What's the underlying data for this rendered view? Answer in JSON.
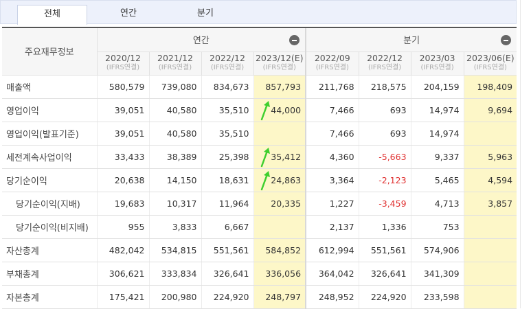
{
  "tabs": [
    {
      "label": "전체",
      "active": true
    },
    {
      "label": "연간",
      "active": false
    },
    {
      "label": "분기",
      "active": false
    }
  ],
  "header": {
    "row_label": "주요재무정보",
    "annual_group": "연간",
    "quarter_group": "분기",
    "periods": [
      {
        "label": "2020/12",
        "sub": "(IFRS연결)"
      },
      {
        "label": "2021/12",
        "sub": "(IFRS연결)"
      },
      {
        "label": "2022/12",
        "sub": "(IFRS연결)"
      },
      {
        "label": "2023/12(E)",
        "sub": "(IFRS연결)"
      },
      {
        "label": "2022/09",
        "sub": "(IFRS연결)"
      },
      {
        "label": "2022/12",
        "sub": "(IFRS연결)"
      },
      {
        "label": "2023/03",
        "sub": "(IFRS연결)"
      },
      {
        "label": "2023/06(E)",
        "sub": "(IFRS연결)"
      }
    ]
  },
  "rows": [
    {
      "label": "매출액",
      "indent": false,
      "arrow": false,
      "values": [
        "580,579",
        "739,080",
        "834,673",
        "857,793",
        "211,768",
        "218,575",
        "204,159",
        "198,409"
      ]
    },
    {
      "label": "영업이익",
      "indent": false,
      "arrow": true,
      "values": [
        "39,051",
        "40,580",
        "35,510",
        "44,000",
        "7,466",
        "693",
        "14,974",
        "9,694"
      ]
    },
    {
      "label": "영업이익(발표기준)",
      "indent": false,
      "arrow": false,
      "values": [
        "39,051",
        "40,580",
        "35,510",
        "",
        "7,466",
        "693",
        "14,974",
        ""
      ]
    },
    {
      "label": "세전계속사업이익",
      "indent": false,
      "arrow": true,
      "values": [
        "33,433",
        "38,389",
        "25,398",
        "35,412",
        "4,360",
        "-5,663",
        "9,337",
        "5,963"
      ]
    },
    {
      "label": "당기순이익",
      "indent": false,
      "arrow": true,
      "values": [
        "20,638",
        "14,150",
        "18,631",
        "24,863",
        "3,364",
        "-2,123",
        "5,465",
        "4,594"
      ]
    },
    {
      "label": "당기순이익(지배)",
      "indent": true,
      "arrow": false,
      "values": [
        "19,683",
        "10,317",
        "11,964",
        "20,335",
        "1,227",
        "-3,459",
        "4,713",
        "3,857"
      ]
    },
    {
      "label": "당기순이익(비지배)",
      "indent": true,
      "arrow": false,
      "values": [
        "955",
        "3,833",
        "6,667",
        "",
        "2,137",
        "1,336",
        "753",
        ""
      ]
    },
    {
      "label": "자산총계",
      "indent": false,
      "arrow": false,
      "values": [
        "482,042",
        "534,815",
        "551,561",
        "584,852",
        "612,994",
        "551,561",
        "574,906",
        ""
      ]
    },
    {
      "label": "부채총계",
      "indent": false,
      "arrow": false,
      "values": [
        "306,621",
        "333,834",
        "326,641",
        "336,056",
        "364,042",
        "326,641",
        "341,309",
        ""
      ]
    },
    {
      "label": "자본총계",
      "indent": false,
      "arrow": false,
      "values": [
        "175,421",
        "200,980",
        "224,920",
        "248,797",
        "248,952",
        "224,920",
        "233,598",
        ""
      ]
    }
  ],
  "colors": {
    "estimate_bg": "#fdf7c8",
    "negative": "#e03030",
    "arrow": "#3fcf2f"
  }
}
